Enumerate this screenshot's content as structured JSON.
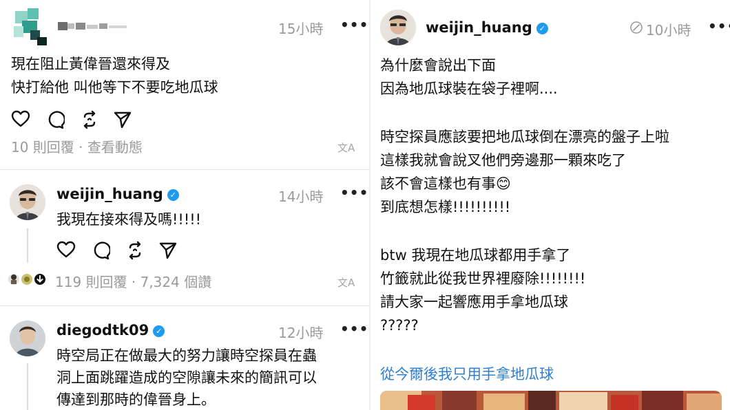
{
  "left": {
    "post1": {
      "username": "",
      "time": "15小時",
      "more": "•••",
      "lines": [
        "現在阻止黃偉晉還來得及",
        "快打給他 叫他等下不要吃地瓜球"
      ],
      "meta": "10 則回覆 · 查看動態",
      "translate_glyph": "文A"
    },
    "reply1": {
      "username": "weijin_huang",
      "time": "14小時",
      "more": "•••",
      "lines": [
        "我現在接來得及嗎!!!!!"
      ],
      "meta": "119 則回覆 · 7,324 個讚",
      "translate_glyph": "文A"
    },
    "post2": {
      "username": "diegodtk09",
      "time": "12小時",
      "more": "•••",
      "lines": [
        "時空局正在做最大的努力讓時空探員在蟲",
        "洞上面跳躍造成的空隙讓未來的簡訊可以",
        "傳達到那時的偉晉身上。"
      ]
    }
  },
  "right": {
    "username": "weijin_huang",
    "time": "10小時",
    "more": "•••",
    "lines": [
      "為什麼會說出下面",
      "因為地瓜球裝在袋子裡啊....",
      "",
      "時空探員應該要把地瓜球倒在漂亮的盤子上啦",
      "這樣我就會說叉他們旁邊那一顆來吃了",
      "該不會這樣也有事😊",
      "到底想怎樣!!!!!!!!!!",
      "",
      "btw 我現在地瓜球都用手拿了",
      "竹籤就此從我世界裡廢除!!!!!!!!",
      "請大家一起響應用手拿地瓜球",
      "?????"
    ],
    "link": "從今爾後我只用手拿地瓜球"
  },
  "colors": {
    "verified": "#1d9bf0",
    "link": "#2f7fd1",
    "muted": "#9a9a9a"
  },
  "icons": [
    "heart-icon",
    "comment-icon",
    "repost-icon",
    "share-icon",
    "translate-icon",
    "verified-icon",
    "edited-icon",
    "more-icon"
  ]
}
